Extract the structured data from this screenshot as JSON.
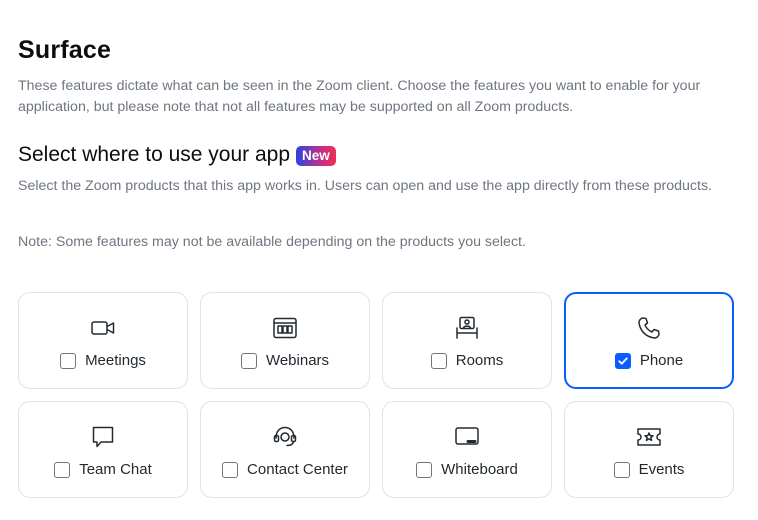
{
  "section": {
    "title": "Surface",
    "description": "These features dictate what can be seen in the Zoom client. Choose the features you want to enable for your application, but please note that not all features may be supported on all Zoom products."
  },
  "select": {
    "title": "Select where to use your app",
    "badge": "New",
    "description": "Select the Zoom products that this app works in. Users can open and use the app directly from these products.",
    "note": "Note: Some features may not be available depending on the products you select."
  },
  "products": [
    {
      "label": "Meetings",
      "icon": "video-camera-icon",
      "checked": false
    },
    {
      "label": "Webinars",
      "icon": "webinar-icon",
      "checked": false
    },
    {
      "label": "Rooms",
      "icon": "rooms-icon",
      "checked": false
    },
    {
      "label": "Phone",
      "icon": "phone-icon",
      "checked": true
    },
    {
      "label": "Team Chat",
      "icon": "chat-bubble-icon",
      "checked": false
    },
    {
      "label": "Contact Center",
      "icon": "headset-icon",
      "checked": false
    },
    {
      "label": "Whiteboard",
      "icon": "whiteboard-icon",
      "checked": false
    },
    {
      "label": "Events",
      "icon": "ticket-icon",
      "checked": false
    }
  ],
  "colors": {
    "accent": "#0b5cff",
    "border": "#dfe3e8",
    "muted_text": "#6e7680"
  }
}
